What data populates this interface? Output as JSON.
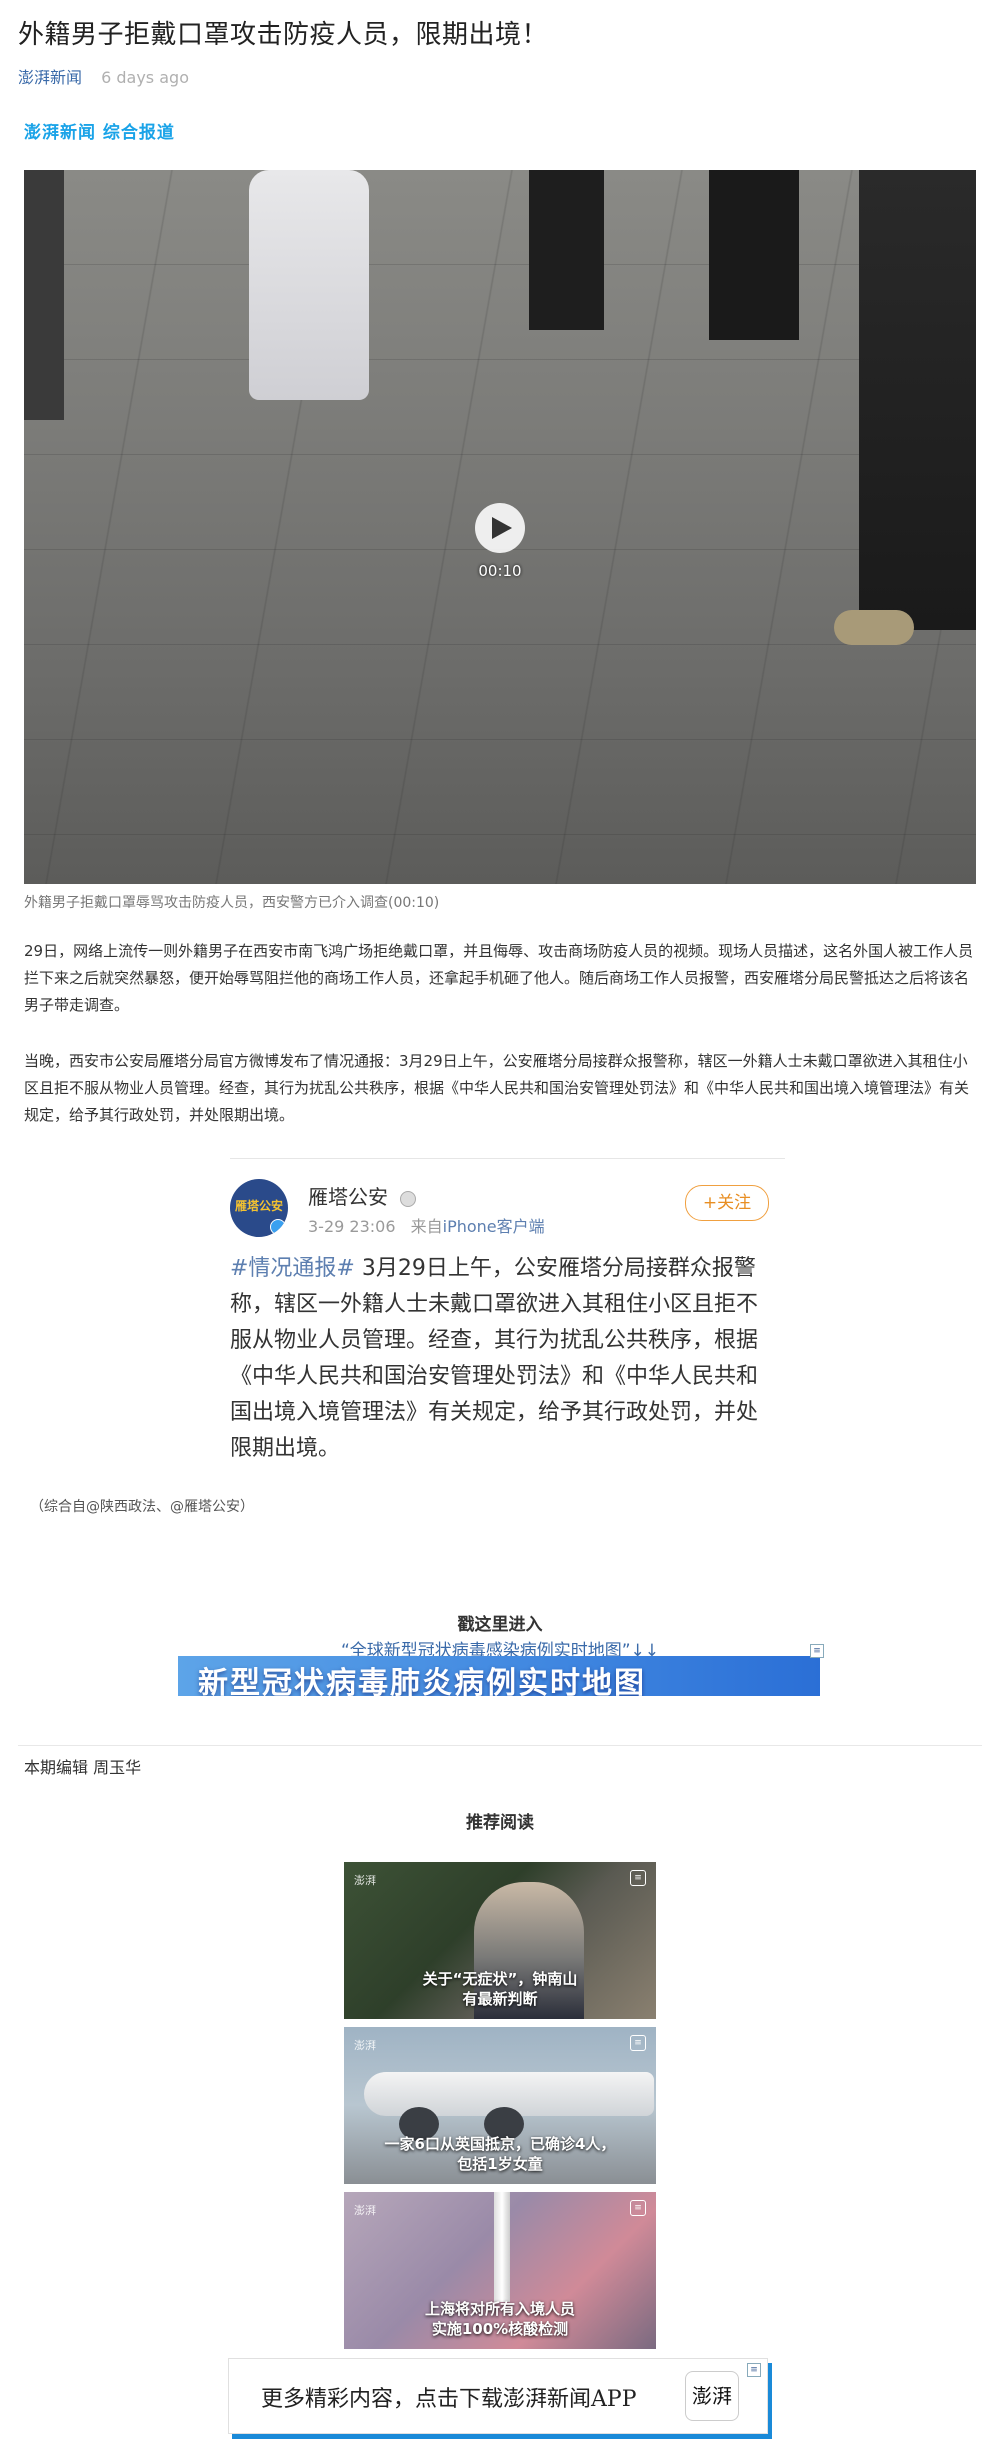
{
  "article": {
    "title": "外籍男子拒戴口罩攻击防疫人员，限期出境！",
    "source": "澎湃新闻",
    "time_ago": "6 days ago",
    "channel": "澎湃新闻 综合报道"
  },
  "video": {
    "duration": "00:10",
    "caption": "外籍男子拒戴口罩辱骂攻击防疫人员，西安警方已介入调查(00:10)"
  },
  "paragraphs": [
    "29日，网络上流传一则外籍男子在西安市南飞鸿广场拒绝戴口罩，并且侮辱、攻击商场防疫人员的视频。现场人员描述，这名外国人被工作人员拦下来之后就突然暴怒，便开始辱骂阻拦他的商场工作人员，还拿起手机砸了他人。随后商场工作人员报警，西安雁塔分局民警抵达之后将该名男子带走调查。",
    "当晚，西安市公安局雁塔分局官方微博发布了情况通报：3月29日上午，公安雁塔分局接群众报警称，辖区一外籍人士未戴口罩欲进入其租住小区且拒不服从物业人员管理。经查，其行为扰乱公共秩序，根据《中华人民共和国治安管理处罚法》和《中华人民共和国出境入境管理法》有关规定，给予其行政处罚，并处限期出境。"
  ],
  "weibo": {
    "account": "雁塔公安",
    "avatar_text": "雁塔公安",
    "time": "3-29 23:06",
    "device_prefix": "来自",
    "device": "iPhone客户端",
    "follow_label": "+关注",
    "hashtag": "#情况通报#",
    "body": " 3月29日上午，公安雁塔分局接群众报警称，辖区一外籍人士未戴口罩欲进入其租住小区且拒不服从物业人员管理。经查，其行为扰乱公共秩序，根据《中华人民共和国治安管理处罚法》和《中华人民共和国出境入境管理法》有关规定，给予其行政处罚，并处限期出境。"
  },
  "source_note": "（综合自@陕西政法、@雁塔公安）",
  "map_promo": {
    "heading": "戳这里进入",
    "link_text": "“全球新型冠状病毒感染病例实时地图”↓↓",
    "banner_text": "新型冠状病毒肺炎病例实时地图"
  },
  "editor": "本期编辑 周玉华",
  "recommended": {
    "title": "推荐阅读",
    "items": [
      {
        "caption_line1": "关于“无症状”，钟南山",
        "caption_line2": "有最新判断",
        "logo": "澎湃"
      },
      {
        "caption_line1": "一家6口从英国抵京，已确诊4人，",
        "caption_line2": "包括1岁女童",
        "logo": "澎湃"
      },
      {
        "caption_line1": "上海将对所有入境人员",
        "caption_line2": "实施100%核酸检测",
        "logo": "澎湃"
      }
    ]
  },
  "app_banner": {
    "text": "更多精彩内容，点击下载澎湃新闻APP",
    "logo": "澎湃"
  },
  "colors": {
    "channel_blue": "#1aa3e8",
    "link_blue": "#3a6aa9",
    "follow_orange": "#e88e22",
    "banner_shadow": "#1a8ad8"
  },
  "icons": [
    "play-icon",
    "verified-icon",
    "ad-badge-icon"
  ]
}
